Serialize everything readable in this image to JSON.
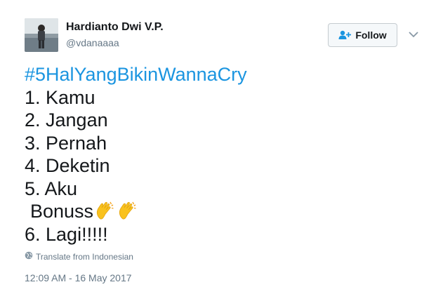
{
  "author": {
    "display_name": "Hardianto Dwi V.P.",
    "handle": "@vdanaaaa",
    "avatar_icon": "profile-photo"
  },
  "follow_button": {
    "label": "Follow",
    "icon": "add-user-icon"
  },
  "menu_caret": {
    "icon": "chevron-down-icon"
  },
  "tweet": {
    "hashtag": "#5HalYangBikinWannaCry",
    "lines": [
      "1. Kamu",
      "2. Jangan",
      "3. Pernah",
      "4. Deketin",
      "5. Aku",
      "Bonuss",
      "6. Lagi!!!!!"
    ],
    "emoji": "clapping-hands-icon"
  },
  "translate": {
    "label": "Translate from Indonesian",
    "icon": "globe-icon"
  },
  "timestamp": "12:09 AM - 16 May 2017",
  "colors": {
    "hashtag": "#1b95e0",
    "secondary_text": "#657786",
    "primary_text": "#14171a"
  }
}
